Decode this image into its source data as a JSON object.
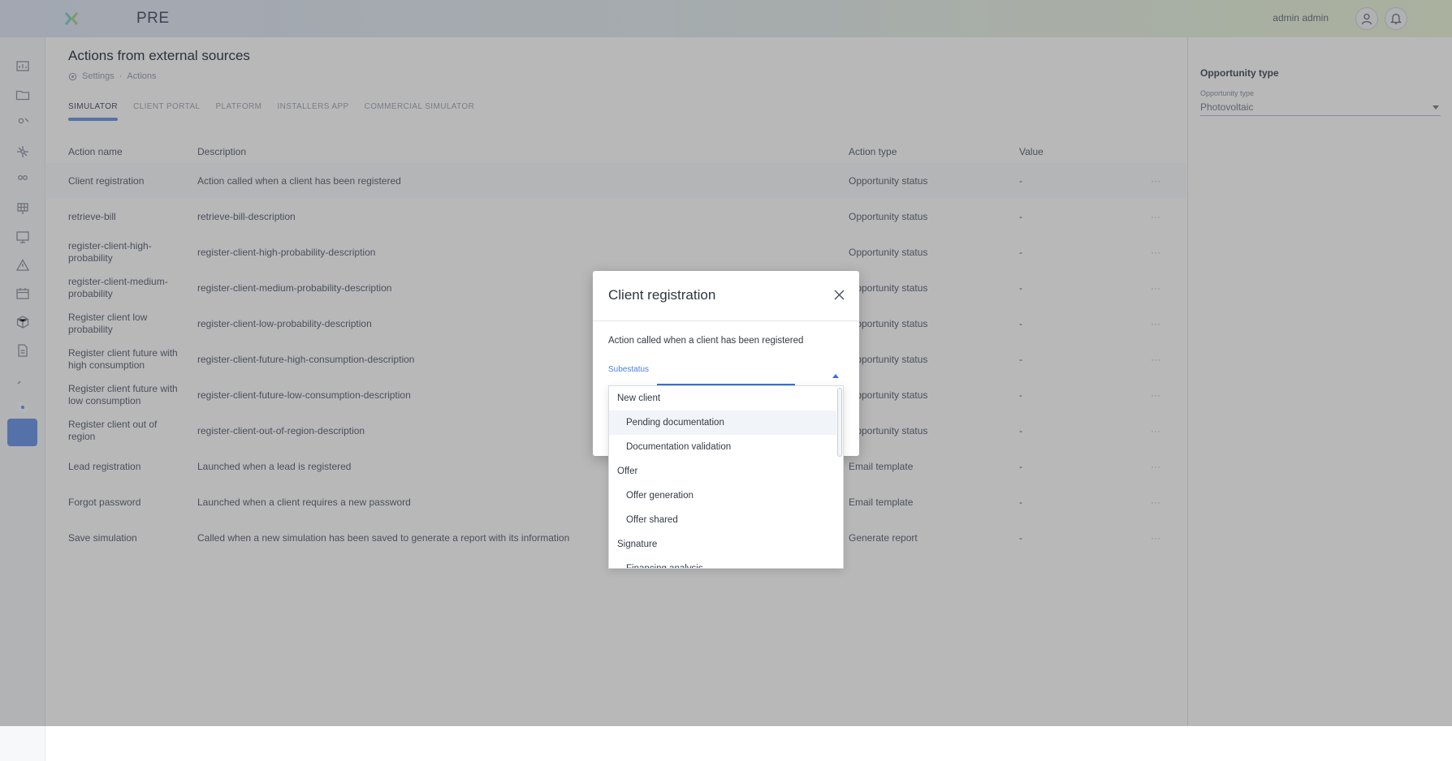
{
  "app": {
    "brand": "PRE",
    "user_name": "admin admin",
    "icons": {
      "logo": "x-logo-icon",
      "user": "user-icon",
      "bell": "bell-icon"
    }
  },
  "sidebar": {
    "items": [
      {
        "icon": "dashboard-icon"
      },
      {
        "icon": "folder-icon"
      },
      {
        "icon": "users-icon"
      },
      {
        "icon": "network-icon"
      },
      {
        "icon": "group-icon"
      },
      {
        "icon": "solar-panel-icon"
      },
      {
        "icon": "monitor-icon"
      },
      {
        "icon": "warning-icon"
      },
      {
        "icon": "calendar-icon"
      },
      {
        "icon": "box-icon"
      },
      {
        "icon": "document-icon"
      },
      {
        "icon": "rocket-icon"
      },
      {
        "icon": "settings-icon",
        "active": true
      }
    ]
  },
  "page": {
    "title": "Actions from external sources",
    "breadcrumb": [
      "Settings",
      "Actions"
    ],
    "breadcrumb_separator": "·",
    "tabs": [
      "SIMULATOR",
      "CLIENT PORTAL",
      "PLATFORM",
      "INSTALLERS APP",
      "COMMERCIAL SIMULATOR"
    ],
    "active_tab": "SIMULATOR"
  },
  "table": {
    "columns": [
      "Action name",
      "Description",
      "Action type",
      "Value"
    ],
    "rows": [
      {
        "name": "Client registration",
        "description": "Action called when a client has been registered",
        "type": "Opportunity status",
        "value": "-"
      },
      {
        "name": "retrieve-bill",
        "description": "retrieve-bill-description",
        "type": "Opportunity status",
        "value": "-"
      },
      {
        "name": "register-client-high-probability",
        "description": "register-client-high-probability-description",
        "type": "Opportunity status",
        "value": "-"
      },
      {
        "name": "register-client-medium-probability",
        "description": "register-client-medium-probability-description",
        "type": "Opportunity status",
        "value": "-"
      },
      {
        "name": "Register client low probability",
        "description": "register-client-low-probability-description",
        "type": "Opportunity status",
        "value": "-"
      },
      {
        "name": "Register client future with high consumption",
        "description": "register-client-future-high-consumption-description",
        "type": "Opportunity status",
        "value": "-"
      },
      {
        "name": "Register client future with low consumption",
        "description": "register-client-future-low-consumption-description",
        "type": "Opportunity status",
        "value": "-"
      },
      {
        "name": "Register client out of region",
        "description": "register-client-out-of-region-description",
        "type": "Opportunity status",
        "value": "-"
      },
      {
        "name": "Lead registration",
        "description": "Launched when a lead is registered",
        "type": "Email template",
        "value": "-"
      },
      {
        "name": "Forgot password",
        "description": "Launched when a client requires a new password",
        "type": "Email template",
        "value": "-"
      },
      {
        "name": "Save simulation",
        "description": "Called when a new simulation has been saved to generate a report with its information",
        "type": "Generate report",
        "value": "-"
      }
    ],
    "more_label": "···"
  },
  "right_panel": {
    "title": "Opportunity type",
    "field_label": "Opportunity type",
    "field_value": "Photovoltaic"
  },
  "modal": {
    "title": "Client registration",
    "description": "Action called when a client has been registered",
    "field_label": "Subestatus"
  },
  "dropdown": {
    "items": [
      {
        "label": "New client",
        "kind": "group"
      },
      {
        "label": "Pending documentation",
        "kind": "option",
        "hover": true
      },
      {
        "label": "Documentation validation",
        "kind": "option"
      },
      {
        "label": "Offer",
        "kind": "group"
      },
      {
        "label": "Offer generation",
        "kind": "option"
      },
      {
        "label": "Offer shared",
        "kind": "option"
      },
      {
        "label": "Signature",
        "kind": "group"
      },
      {
        "label": "Financing analysis",
        "kind": "option"
      }
    ]
  },
  "colors": {
    "accent": "#6d97e8",
    "field_active": "#3d6fd9",
    "overlay": "rgba(33,35,38,0.32)"
  }
}
